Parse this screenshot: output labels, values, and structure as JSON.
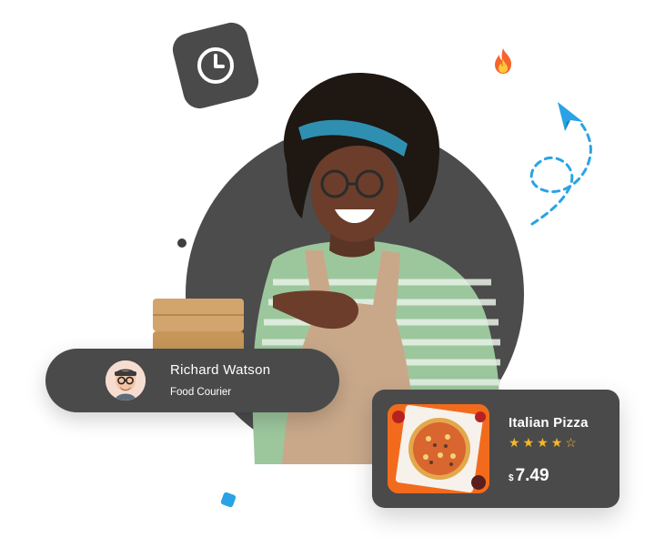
{
  "courier": {
    "name": "Richard Watson",
    "role": "Food Courier"
  },
  "product": {
    "name": "Italian Pizza",
    "rating": 4,
    "rating_max": 5,
    "currency": "$",
    "price": "7.49"
  },
  "icons": {
    "clock": "clock-icon",
    "fire": "fire-icon",
    "plane": "paper-plane-icon"
  },
  "colors": {
    "card_bg": "#4a4a4a",
    "accent_blue": "#29a3e6",
    "star": "#f5b82e"
  }
}
